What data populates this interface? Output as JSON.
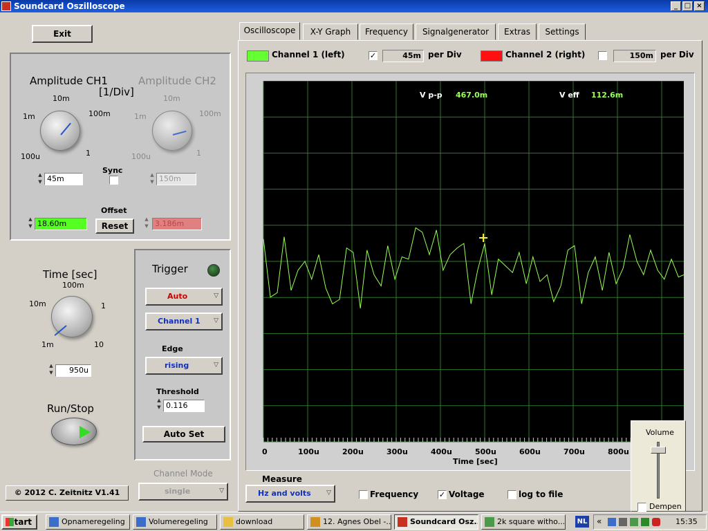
{
  "window": {
    "title": "Soundcard Oszilloscope",
    "min": "_",
    "max": "□",
    "close": "×"
  },
  "left": {
    "exit": "Exit",
    "amp_ch1": "Amplitude CH1",
    "amp_unit": "[1/Div]",
    "amp_ch2": "Amplitude CH2",
    "ticks": {
      "t10m": "10m",
      "t1m": "1m",
      "t100m": "100m",
      "t100u": "100u",
      "t1": "1"
    },
    "ch1_amp_value": "45m",
    "ch2_amp_value": "150m",
    "sync": "Sync",
    "offset": "Offset",
    "ch1_offset": "18.60m",
    "ch2_offset": "3.186m",
    "reset": "Reset",
    "time_label": "Time [sec]",
    "time_ticks": {
      "t100m": "100m",
      "t10m": "10m",
      "t1": "1",
      "t1m": "1m",
      "t10": "10"
    },
    "time_value": "950u",
    "run_stop": "Run/Stop",
    "copyright": "© 2012  C. Zeitnitz V1.41",
    "channel_mode_label": "Channel Mode",
    "channel_mode_value": "single"
  },
  "trigger": {
    "title": "Trigger",
    "mode": "Auto",
    "channel": "Channel 1",
    "edge_label": "Edge",
    "edge": "rising",
    "threshold_label": "Threshold",
    "threshold": "0.116",
    "autoset": "Auto Set",
    "mode_color": "#cc0000",
    "channel_color": "#1030c0"
  },
  "tabs": [
    "Oscilloscope",
    "X-Y Graph",
    "Frequency",
    "Signalgenerator",
    "Extras",
    "Settings"
  ],
  "channels": {
    "ch1_label": "Channel 1 (left)",
    "ch1_color": "#66ff33",
    "ch1_checked": "✓",
    "ch1_per_div": "45m",
    "per_div": "per Div",
    "ch2_label": "Channel 2 (right)",
    "ch2_color": "#ff1111",
    "ch2_per_div": "150m"
  },
  "scope": {
    "vpp_label": "V p-p",
    "vpp_value": "467.0m",
    "veff_label": "V eff",
    "veff_value": "112.6m",
    "xlabel": "Time [sec]",
    "x_ticks": [
      "0",
      "100u",
      "200u",
      "300u",
      "400u",
      "500u",
      "600u",
      "700u",
      "800u"
    ],
    "trace_color": "#99ff55",
    "grid_color": "#2e7a2e"
  },
  "chart_data": {
    "type": "line",
    "xlabel": "Time [sec]",
    "xlim": [
      0,
      0.00095
    ],
    "ylim": [
      -5,
      5
    ],
    "x": [
      0,
      1.56e-05,
      3.13e-05,
      4.69e-05,
      6.25e-05,
      7.81e-05,
      9.38e-05,
      0.000109,
      0.000125,
      0.000141,
      0.000156,
      0.000172,
      0.000188,
      0.000203,
      0.000219,
      0.000234,
      0.00025,
      0.000266,
      0.000281,
      0.000297,
      0.000313,
      0.000328,
      0.000344,
      0.000359,
      0.000375,
      0.000391,
      0.000406,
      0.000422,
      0.000438,
      0.000453,
      0.000469,
      0.000484,
      0.0005,
      0.000516,
      0.000531,
      0.000547,
      0.000563,
      0.000578,
      0.000594,
      0.000609,
      0.000625,
      0.000641,
      0.000656,
      0.000672,
      0.000688,
      0.000703,
      0.000719,
      0.000734,
      0.00075,
      0.000766,
      0.000781,
      0.000797,
      0.000813,
      0.000828,
      0.000844,
      0.000859,
      0.000875,
      0.000891,
      0.000906,
      0.000922,
      0.000938,
      0.00095
    ],
    "series": [
      {
        "values": [
          1.0,
          -1.6,
          -1.4,
          1.1,
          -1.3,
          -0.4,
          0.0,
          -0.8,
          0.3,
          -1.2,
          -1.9,
          -1.7,
          0.6,
          0.4,
          -2.1,
          0.5,
          -0.6,
          -1.1,
          0.7,
          -0.8,
          0.2,
          0.1,
          1.5,
          1.3,
          0.3,
          1.4,
          -0.4,
          0.3,
          0.6,
          0.8,
          -1.9,
          -0.4,
          0.8,
          -1.5,
          0.1,
          -0.2,
          -0.5,
          0.4,
          -1.0,
          0.2,
          -0.9,
          -0.6,
          -1.8,
          -1.1,
          0.5,
          0.7,
          -1.9,
          -0.5,
          0.2,
          -1.3,
          0.4,
          -1.0,
          -0.3,
          1.2,
          0.0,
          -0.6,
          0.5,
          -0.4,
          -0.8,
          0.1,
          -0.7,
          -0.6
        ]
      }
    ],
    "marker": {
      "x": 0.000497,
      "y": 1.05
    }
  },
  "bottom": {
    "measure_label": "Measure",
    "measure_value": "Hz and volts",
    "frequency": "Frequency",
    "voltage": "Voltage",
    "voltage_checked": "✓",
    "log": "log to file"
  },
  "volume": {
    "title": "Volume",
    "mute": "Dempen",
    "level": 0.9
  },
  "taskbar": {
    "start": "Start",
    "items": [
      "Opnameregeling",
      "Volumeregeling",
      "download",
      "12. Agnes Obel -...",
      "Soundcard Osz...",
      "2k square  witho..."
    ],
    "lang": "NL",
    "tray_arrows": "«",
    "clock": "15:35"
  }
}
